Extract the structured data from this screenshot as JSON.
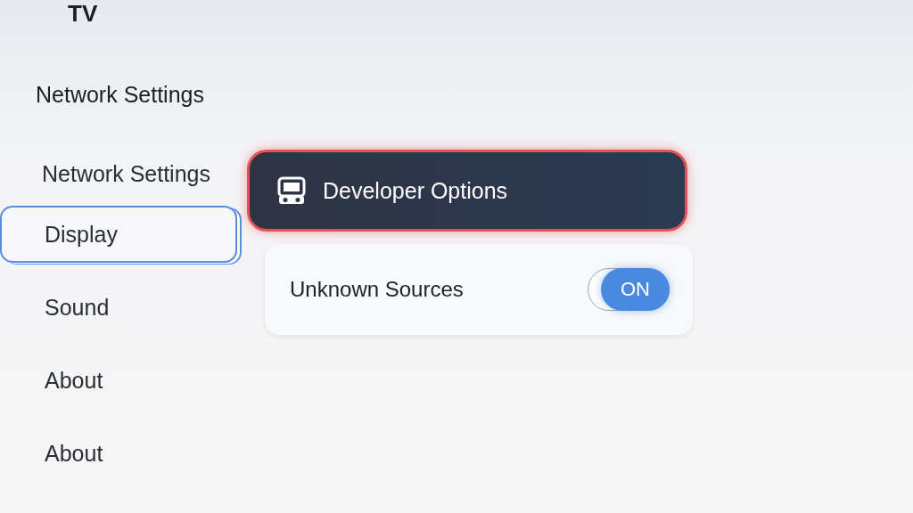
{
  "app_title": "TV",
  "sidebar": {
    "heading": "Network Settings",
    "items": [
      {
        "label": "Network Settings",
        "selected": false
      },
      {
        "label": "Display",
        "selected": true
      },
      {
        "label": "Sound",
        "selected": false
      },
      {
        "label": "About",
        "selected": false
      },
      {
        "label": "About",
        "selected": false
      }
    ]
  },
  "panel": {
    "header": {
      "title": "Developer Options",
      "focused": true
    },
    "settings": [
      {
        "kind": "toggle",
        "label": "Unknown Sources",
        "on": true,
        "state_text": "ON"
      }
    ]
  }
}
